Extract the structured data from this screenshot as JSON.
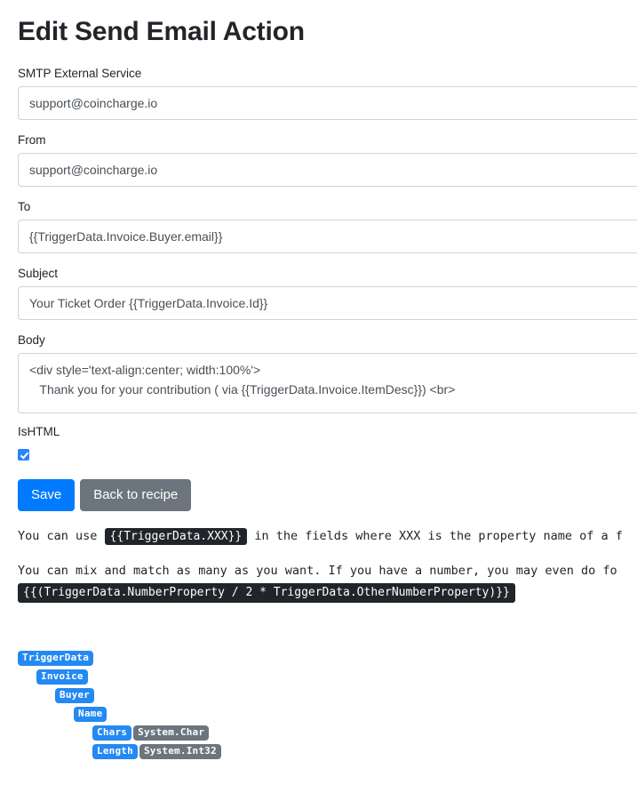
{
  "page": {
    "title": "Edit Send Email Action"
  },
  "form": {
    "smtp": {
      "label": "SMTP External Service",
      "value": "support@coincharge.io",
      "options": [
        "support@coincharge.io"
      ]
    },
    "from": {
      "label": "From",
      "value": "support@coincharge.io",
      "placeholder": ""
    },
    "to": {
      "label": "To",
      "value": "{{TriggerData.Invoice.Buyer.email}}",
      "placeholder": ""
    },
    "subject": {
      "label": "Subject",
      "value": "Your Ticket Order {{TriggerData.Invoice.Id}}",
      "placeholder": ""
    },
    "body": {
      "label": "Body",
      "value": "<div style='text-align:center; width:100%'>\n   Thank you for your contribution ( via {{TriggerData.Invoice.ItemDesc}}) <br>\n   ",
      "placeholder": ""
    },
    "ishtml": {
      "label": "IsHTML",
      "checked": true
    }
  },
  "buttons": {
    "save": "Save",
    "back": "Back to recipe"
  },
  "help": {
    "line1_before": "You can use",
    "line1_code": "{{TriggerData.XXX}}",
    "line1_after": "in the fields where XXX  is the property name of a f",
    "line2": "You can mix and match as many as you want. If you have a number, you may even do fo",
    "line2_code": "{{(TriggerData.NumberProperty / 2 * TriggerData.OtherNumberProperty)}}"
  },
  "tree": [
    {
      "indent": 0,
      "name": "TriggerData",
      "type": ""
    },
    {
      "indent": 1,
      "name": "Invoice",
      "type": ""
    },
    {
      "indent": 2,
      "name": "Buyer",
      "type": ""
    },
    {
      "indent": 3,
      "name": "Name",
      "type": ""
    },
    {
      "indent": 4,
      "name": "Chars",
      "type": "System.Char"
    },
    {
      "indent": 4,
      "name": "Length",
      "type": "System.Int32"
    }
  ],
  "colors": {
    "primary": "#007bff",
    "secondary": "#6c757d",
    "node": "#2489f2",
    "code_bg": "#212529",
    "border": "#ced4da"
  }
}
